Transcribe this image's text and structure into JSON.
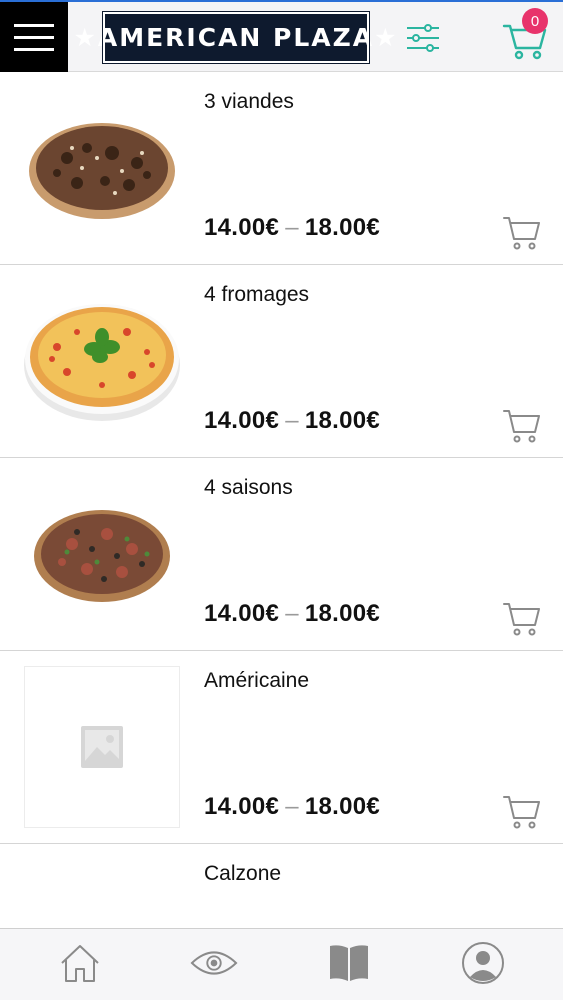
{
  "header": {
    "logo_text": "★AMERICAN PLAZA★",
    "cart_count": "0"
  },
  "products": [
    {
      "name": "3 viandes",
      "price_min": "14.00€",
      "price_sep": "–",
      "price_max": "18.00€",
      "image": "pizza-meat"
    },
    {
      "name": "4 fromages",
      "price_min": "14.00€",
      "price_sep": "–",
      "price_max": "18.00€",
      "image": "pizza-cheese"
    },
    {
      "name": "4 saisons",
      "price_min": "14.00€",
      "price_sep": "–",
      "price_max": "18.00€",
      "image": "pizza-seasons"
    },
    {
      "name": "Américaine",
      "price_min": "14.00€",
      "price_sep": "–",
      "price_max": "18.00€",
      "image": "placeholder"
    },
    {
      "name": "Calzone",
      "price_min": "",
      "price_sep": "",
      "price_max": "",
      "image": "calzone"
    }
  ],
  "tabbar": {
    "tabs": [
      "home-icon",
      "eye-icon",
      "book-icon",
      "user-icon"
    ]
  },
  "colors": {
    "accent_teal": "#2bb5a0",
    "badge": "#e8336b",
    "logo_bg": "#0e1a2e",
    "icon_gray": "#8a8a8a"
  }
}
